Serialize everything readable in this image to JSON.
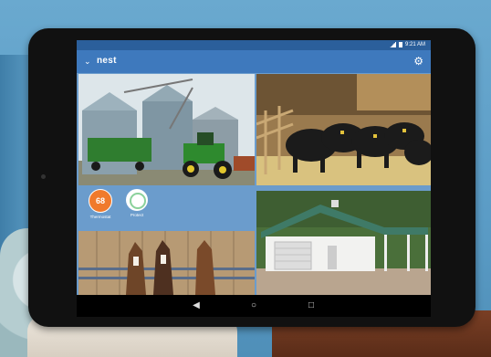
{
  "status_bar": {
    "time": "9:21 AM"
  },
  "app_bar": {
    "brand": "nest"
  },
  "widgets": {
    "thermostat": {
      "value": "68",
      "label": "Thermostat"
    },
    "protect": {
      "label": "Protect"
    }
  },
  "cameras": [
    {
      "name": "farm-silos-camera",
      "subject": "grain bins with tractor"
    },
    {
      "name": "barn-cattle-camera",
      "subject": "cattle in barn"
    },
    {
      "name": "horses-camera",
      "subject": "horses at fence"
    },
    {
      "name": "garage-camera",
      "subject": "white garage building"
    }
  ],
  "nav": {
    "back": "◀",
    "home": "○",
    "recent": "□"
  },
  "colors": {
    "app_bar": "#3e79bd",
    "status_bar": "#2b5f9b",
    "thermostat": "#f07a2c",
    "protect_ring": "#8bd19b"
  }
}
